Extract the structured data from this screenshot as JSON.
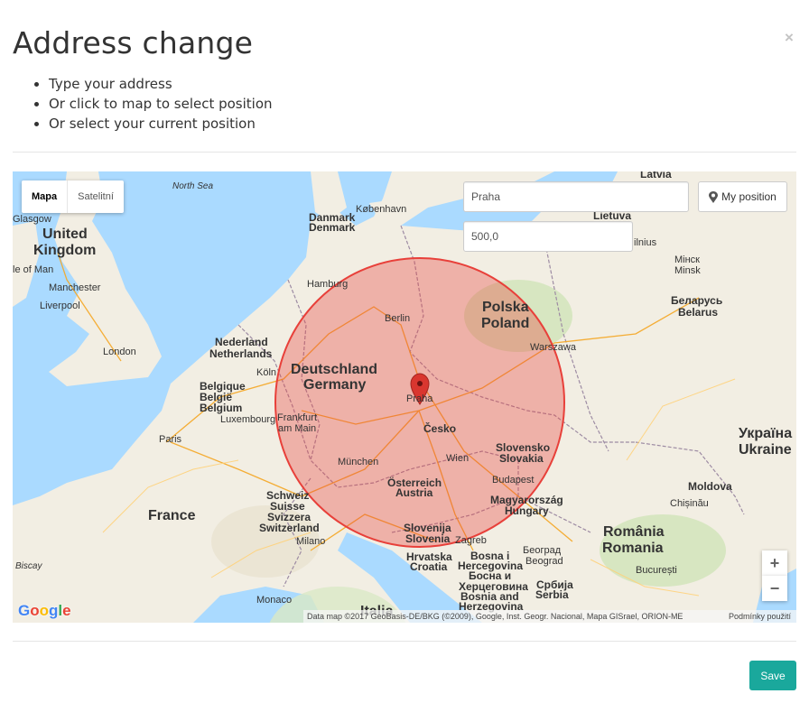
{
  "modal": {
    "title": "Address change",
    "close_symbol": "×",
    "instructions": [
      "Type your address",
      "Or click to map to select position",
      "Or select your current position"
    ],
    "save_label": "Save",
    "save_color": "#1aa89c"
  },
  "map": {
    "type_tabs": [
      "Mapa",
      "Satelitní"
    ],
    "active_tab": "Mapa",
    "address_value": "Praha",
    "radius_value": "500,0",
    "my_position_label": "My position",
    "my_position_icon": "map-marker-icon",
    "zoom_in": "+",
    "zoom_out": "−",
    "attribution": "Data map ©2017 GeoBasis-DE/BKG (©2009), Google, Inst. Geogr. Nacional, Mapa GISrael, ORION-ME",
    "terms": "Podmínky použití",
    "google_logo": "Google",
    "circle_color": "#e8403a",
    "marker_icon": "map-pin-icon",
    "labels": {
      "north_sea": "North Sea",
      "biscay": "Biscay",
      "latvia": "Latvia",
      "uk_1": "United",
      "uk_2": "Kingdom",
      "isle_of_man": "le of Man",
      "glasgow": "Glasgow",
      "manchester": "Manchester",
      "liverpool": "Liverpool",
      "london": "London",
      "danmark_1": "Danmark",
      "danmark_2": "Denmark",
      "kobenhavn": "København",
      "lietuva": "Lietuva",
      "vilnius": "ilnius",
      "minsk_by": "Мінск",
      "minsk": "Minsk",
      "belarus_by": "Беларусь",
      "belarus": "Belarus",
      "hamburg": "Hamburg",
      "berlin": "Berlin",
      "polska": "Polska",
      "poland": "Poland",
      "warszawa": "Warszawa",
      "nederland": "Nederland",
      "netherlands": "Netherlands",
      "koln": "Köln",
      "belgique": "Belgique",
      "belgie": "België",
      "belgium": "Belgium",
      "luxembourg": "Luxembourg",
      "deutschland": "Deutschland",
      "germany": "Germany",
      "praha": "Praha",
      "cesko": "Česko",
      "frankfurt_1": "Frankfurt",
      "frankfurt_2": "am Main",
      "ukraina": "Україна",
      "ukraine": "Ukraine",
      "paris": "Paris",
      "slovensko": "Slovensko",
      "slovakia": "Slovakia",
      "munchen": "München",
      "wien": "Wien",
      "budapest": "Budapest",
      "osterreich": "Österreich",
      "austria": "Austria",
      "magyarorszag": "Magyarország",
      "hungary": "Hungary",
      "moldova": "Moldova",
      "chisinau": "Chișinău",
      "schweiz": "Schweiz",
      "suisse": "Suisse",
      "svizzera": "Svizzera",
      "switzerland": "Switzerland",
      "france": "France",
      "milano": "Milano",
      "slovenija": "Slovenija",
      "slovenia": "Slovenia",
      "zagreb": "Zagreb",
      "hrvatska": "Hrvatska",
      "croatia": "Croatia",
      "bosna_1": "Bosna i",
      "bosna_2": "Hercegovina",
      "bosna_cy_1": "Босна и",
      "bosna_cy_2": "Херцеговина",
      "bosnia_1": "Bosnia and",
      "bosnia_2": "Herzegovina",
      "beograd_cy": "Београд",
      "beograd": "Beograd",
      "srbija_cy": "Србија",
      "serbia": "Serbia",
      "romania_ro": "România",
      "romania": "Romania",
      "bucuresti": "București",
      "monaco": "Monaco",
      "italia": "Italia"
    }
  }
}
